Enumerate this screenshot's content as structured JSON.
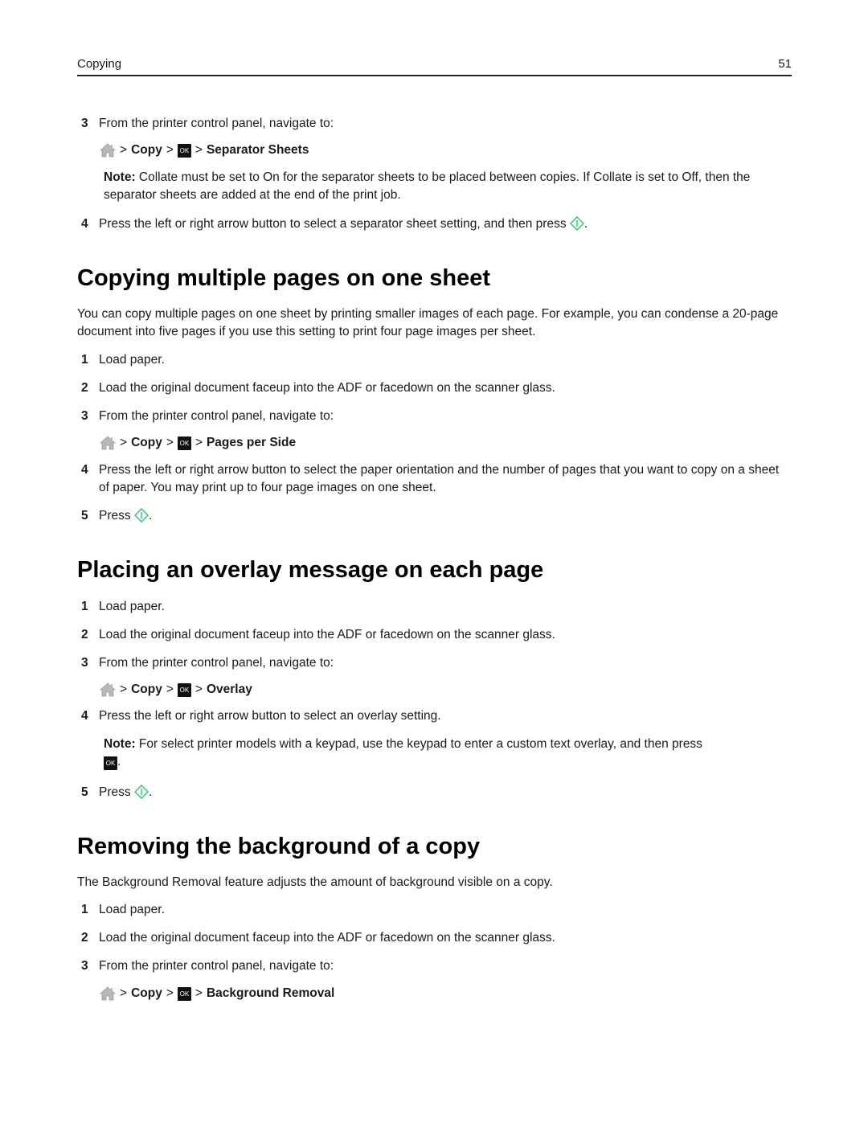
{
  "header": {
    "section": "Copying",
    "page_number": "51"
  },
  "icons": {
    "home": "home-icon",
    "ok": "OK",
    "start": "start-diamond-icon",
    "start_color": "#2ecc71"
  },
  "block1": {
    "step3": {
      "num": "3",
      "text": "From the printer control panel, navigate to:"
    },
    "nav": {
      "copy": "Copy",
      "sep": ">",
      "ok": "OK",
      "dest": "Separator Sheets"
    },
    "note": {
      "label": "Note:",
      "text": " Collate must be set to On for the separator sheets to be placed between copies. If Collate is set to Off, then the separator sheets are added at the end of the print job."
    },
    "step4": {
      "num": "4",
      "text": "Press the left or right arrow button to select a separator sheet setting, and then press ",
      "end": "."
    }
  },
  "section1": {
    "title": "Copying multiple pages on one sheet",
    "intro": "You can copy multiple pages on one sheet by printing smaller images of each page. For example, you can condense a 20-page document into five pages if you use this setting to print four page images per sheet.",
    "step1": {
      "num": "1",
      "text": "Load paper."
    },
    "step2": {
      "num": "2",
      "text": "Load the original document faceup into the ADF or facedown on the scanner glass."
    },
    "step3": {
      "num": "3",
      "text": "From the printer control panel, navigate to:"
    },
    "nav": {
      "copy": "Copy",
      "sep": ">",
      "ok": "OK",
      "dest": "Pages per Side"
    },
    "step4": {
      "num": "4",
      "text": "Press the left or right arrow button to select the paper orientation and the number of pages that you want to copy on a sheet of paper. You may print up to four page images on one sheet."
    },
    "step5": {
      "num": "5",
      "text": "Press ",
      "end": "."
    }
  },
  "section2": {
    "title": "Placing an overlay message on each page",
    "step1": {
      "num": "1",
      "text": "Load paper."
    },
    "step2": {
      "num": "2",
      "text": "Load the original document faceup into the ADF or facedown on the scanner glass."
    },
    "step3": {
      "num": "3",
      "text": "From the printer control panel, navigate to:"
    },
    "nav": {
      "copy": "Copy",
      "sep": ">",
      "ok": "OK",
      "dest": "Overlay"
    },
    "step4": {
      "num": "4",
      "text": "Press the left or right arrow button to select an overlay setting."
    },
    "note": {
      "label": "Note:",
      "text": " For select printer models with a keypad, use the keypad to enter a custom text overlay, and then press",
      "ok": "OK",
      "end": "."
    },
    "step5": {
      "num": "5",
      "text": "Press ",
      "end": "."
    }
  },
  "section3": {
    "title": "Removing the background of a copy",
    "intro": "The Background Removal feature adjusts the amount of background visible on a copy.",
    "step1": {
      "num": "1",
      "text": "Load paper."
    },
    "step2": {
      "num": "2",
      "text": "Load the original document faceup into the ADF or facedown on the scanner glass."
    },
    "step3": {
      "num": "3",
      "text": "From the printer control panel, navigate to:"
    },
    "nav": {
      "copy": "Copy",
      "sep": ">",
      "ok": "OK",
      "dest": "Background Removal"
    }
  }
}
